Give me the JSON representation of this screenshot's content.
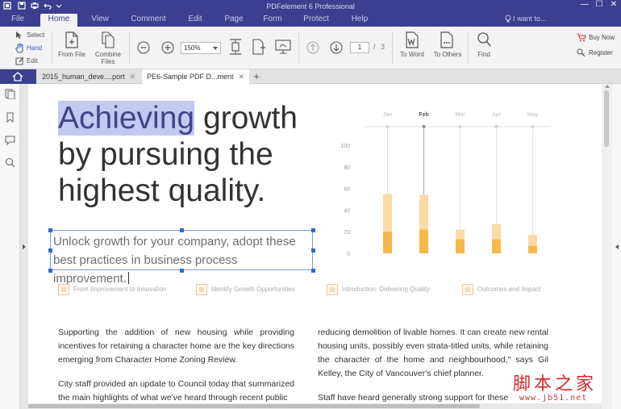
{
  "window": {
    "title": "PDFelement 6 Professional",
    "controls": [
      "—",
      "☐",
      "✕"
    ]
  },
  "menu": {
    "items": [
      "File",
      "Home",
      "View",
      "Comment",
      "Edit",
      "Page",
      "Form",
      "Protect",
      "Help"
    ],
    "active": "Home",
    "search_hint": "I want to..."
  },
  "ribbon": {
    "modes": [
      "Select",
      "Hand",
      "Edit"
    ],
    "active_mode": "Hand",
    "from_file": "From File",
    "combine_files": [
      "Combine",
      "Files"
    ],
    "zoom": "150%",
    "current_page": "1",
    "page_separator": "/",
    "total_pages": "3",
    "to_word": "To Word",
    "to_others": "To Others",
    "find": "Find",
    "buy_now": "Buy Now",
    "register": "Register"
  },
  "tabs": {
    "items": [
      {
        "label": "2015_human_deve....port",
        "close": "✕"
      },
      {
        "label": "PE6-Sample PDF D...ment",
        "close": "✕"
      }
    ],
    "new_tab": "+"
  },
  "document": {
    "headline_highlight": "Achieving",
    "headline_rest": " growth by pursuing the highest quality.",
    "subtext": "Unlock growth for your company, adopt these best practices in business process improvement.",
    "sections": [
      "From Improvement to Innovation",
      "Identify Growth Opportunities",
      "Introduction: Delivering Quality",
      "Outcomes and Impact"
    ],
    "col1": [
      "Supporting the addition of new housing while providing incentives for retaining a character home are the key directions emerging from Character Home Zoning Review.",
      "City staff provided an update to Council today that summarized the main highlights of what we've heard through recent public"
    ],
    "col2": [
      "reducing demolition of livable homes. It can create new rental housing units, possibly even strata-titled units, while retaining the character of the home and neighbourhood,\" says Gil Kelley, the City of Vancouver's chief planner.",
      "Staff have heard generally strong support for these"
    ]
  },
  "chart_data": {
    "type": "bar",
    "categories": [
      "Jan",
      "Feb",
      "Mar",
      "Apr",
      "May"
    ],
    "highlighted_category": "Feb",
    "series": [
      {
        "values": [
          20,
          22,
          13,
          13,
          7
        ]
      },
      {
        "values": [
          35,
          32,
          9,
          14,
          10
        ]
      }
    ],
    "stacked": true,
    "ylim": [
      0,
      100
    ],
    "yticks": [
      0,
      20,
      40,
      60,
      80,
      100
    ],
    "colors": [
      "#f5b94a",
      "#fbdaa8"
    ],
    "grid": false
  },
  "watermark": {
    "text": "脚本之家",
    "url": "www.jb51.net"
  },
  "colors": {
    "brand": "#3a3f8f",
    "highlight": "#c2c9f2",
    "selection": "#2e6bd1"
  }
}
